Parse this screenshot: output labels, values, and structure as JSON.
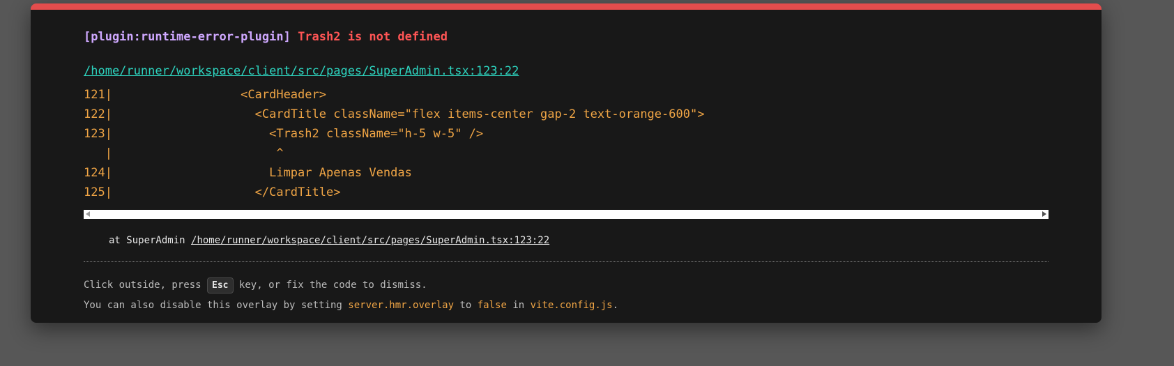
{
  "error": {
    "plugin": "[plugin:runtime-error-plugin]",
    "message": "Trash2 is not defined",
    "file": "/home/runner/workspace/client/src/pages/SuperAdmin.tsx:123:22"
  },
  "frame": {
    "lines": [
      "121|                  <CardHeader>",
      "122|                    <CardTitle className=\"flex items-center gap-2 text-orange-600\">",
      "123|                      <Trash2 className=\"h-5 w-5\" />",
      "   |                       ^",
      "124|                      Limpar Apenas Vendas",
      "125|                    </CardTitle>"
    ]
  },
  "stack": {
    "prefix": "at SuperAdmin ",
    "link": "/home/runner/workspace/client/src/pages/SuperAdmin.tsx:123:22"
  },
  "tip": {
    "line1_before": "Click outside, press ",
    "line1_key": "Esc",
    "line1_after": " key, or fix the code to dismiss.",
    "line2_a": "You can also disable this overlay by setting ",
    "line2_code1": "server.hmr.overlay",
    "line2_b": " to ",
    "line2_code2": "false",
    "line2_c": " in ",
    "line2_code3": "vite.config.js",
    "line2_d": "."
  },
  "colors": {
    "accent_bar": "#e34d4d",
    "plugin": "#cfa8ff",
    "error": "#ff5555",
    "link": "#2dd4bf",
    "code": "#f0a545"
  }
}
